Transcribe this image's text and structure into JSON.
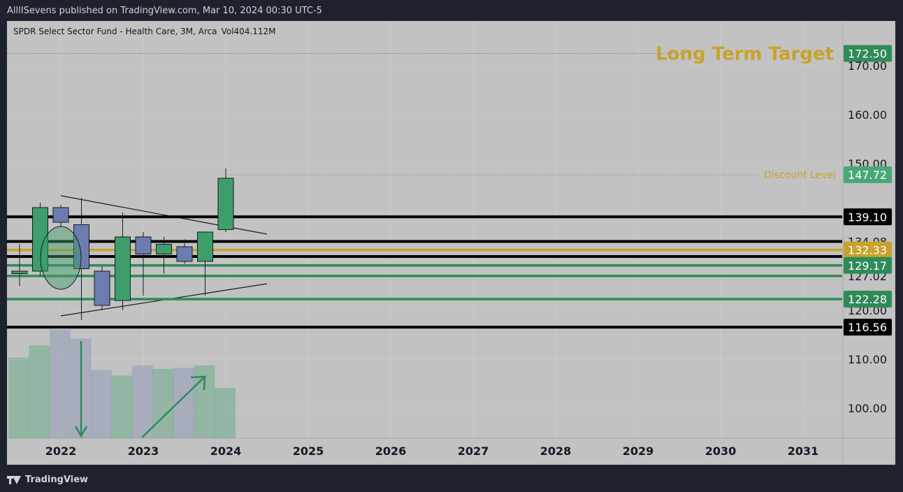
{
  "header": {
    "published": "AlllISevens published on TradingView.com, Mar 10, 2024 00:30 UTC-5"
  },
  "legend": {
    "symbol": "SPDR Select Sector Fund - Health Care, 3M, Arca",
    "volume": "Vol404.112M"
  },
  "footer": {
    "brand": "TradingView"
  },
  "colors": {
    "background": "#c2c2c2",
    "up": "#3d9e6b",
    "down": "#6b7db0",
    "gold": "#c8a22a",
    "green_line": "#2e8b57",
    "black_line": "#000000"
  },
  "chart_data": {
    "type": "candlestick",
    "title": "SPDR Select Sector Fund - Health Care, 3M, Arca",
    "x_labels": [
      "2022",
      "2023",
      "2024",
      "2025",
      "2026",
      "2027",
      "2028",
      "2029",
      "2030",
      "2031"
    ],
    "y_ticks": [
      "100.00",
      "110.00",
      "120.00",
      "127.02",
      "134.08",
      "150.00",
      "160.00",
      "170.00"
    ],
    "ylim": [
      95,
      180
    ],
    "grid": true,
    "candles": [
      {
        "period": "2021-Q4",
        "open": 127.5,
        "high": 133.5,
        "low": 125.0,
        "close": 128.0
      },
      {
        "period": "2022-Q1",
        "open": 128.0,
        "high": 142.0,
        "low": 127.0,
        "close": 141.0
      },
      {
        "period": "2022-Q2",
        "open": 141.0,
        "high": 141.5,
        "low": 137.0,
        "close": 138.0
      },
      {
        "period": "2022-Q3",
        "open": 137.5,
        "high": 143.0,
        "low": 118.0,
        "close": 128.5
      },
      {
        "period": "2022-Q4",
        "open": 128.0,
        "high": 129.0,
        "low": 120.0,
        "close": 121.0
      },
      {
        "period": "2023-Q1",
        "open": 122.0,
        "high": 140.0,
        "low": 120.0,
        "close": 135.0
      },
      {
        "period": "2023-Q2",
        "open": 135.0,
        "high": 136.0,
        "low": 123.0,
        "close": 131.5
      },
      {
        "period": "2023-Q3",
        "open": 131.5,
        "high": 135.0,
        "low": 127.5,
        "close": 133.5
      },
      {
        "period": "2023-Q4",
        "open": 133.0,
        "high": 134.5,
        "low": 129.5,
        "close": 130.0
      },
      {
        "period": "2024-Q1",
        "open": 130.0,
        "high": 136.0,
        "low": 123.0,
        "close": 136.0
      },
      {
        "period": "2024-Q2",
        "open": 136.5,
        "high": 149.0,
        "low": 136.0,
        "close": 147.0
      }
    ],
    "volumes": [
      {
        "period": "2021-Q4",
        "value": 0.72,
        "up": true
      },
      {
        "period": "2022-Q1",
        "value": 0.83,
        "up": true
      },
      {
        "period": "2022-Q2",
        "value": 0.97,
        "up": false
      },
      {
        "period": "2022-Q3",
        "value": 0.89,
        "up": false
      },
      {
        "period": "2022-Q4",
        "value": 0.61,
        "up": false
      },
      {
        "period": "2023-Q1",
        "value": 0.56,
        "up": true
      },
      {
        "period": "2023-Q2",
        "value": 0.65,
        "up": false
      },
      {
        "period": "2023-Q3",
        "value": 0.62,
        "up": true
      },
      {
        "period": "2023-Q4",
        "value": 0.63,
        "up": false
      },
      {
        "period": "2024-Q1",
        "value": 0.65,
        "up": true
      },
      {
        "period": "2024-Q2",
        "value": 0.45,
        "up": true
      }
    ],
    "horizontal_levels": [
      {
        "value": 172.5,
        "color": "#2e8b57",
        "label": "172.50",
        "line": "dotted",
        "annotation": "Long Term Target"
      },
      {
        "value": 147.72,
        "color": "#3d9e6b",
        "label": "147.72",
        "line": "dotted",
        "annotation": "Discount Level"
      },
      {
        "value": 139.1,
        "color": "#000000",
        "label": "139.10",
        "line": "solid"
      },
      {
        "value": 134.08,
        "color": "#000000",
        "label": "",
        "line": "solid"
      },
      {
        "value": 132.33,
        "color": "#c8a22a",
        "label": "132.33",
        "line": "solid"
      },
      {
        "value": 131.0,
        "color": "#000000",
        "label": "",
        "line": "solid"
      },
      {
        "value": 129.17,
        "color": "#2e8b57",
        "label": "129.17",
        "line": "solid"
      },
      {
        "value": 127.02,
        "color": "#2e8b57",
        "label": "",
        "line": "solid"
      },
      {
        "value": 122.28,
        "color": "#2e8b57",
        "label": "122.28",
        "line": "solid"
      },
      {
        "value": 116.56,
        "color": "#000000",
        "label": "116.56",
        "line": "solid"
      }
    ],
    "annotations": {
      "long_term_target": "Long Term Target",
      "discount_level": "Discount Level"
    }
  }
}
